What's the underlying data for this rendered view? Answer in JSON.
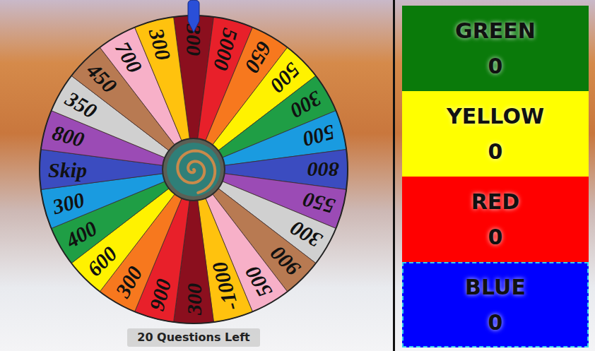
{
  "wheel": {
    "segments": [
      {
        "label": "300",
        "color": "#8b0f1e"
      },
      {
        "label": "5000",
        "color": "#e8202a"
      },
      {
        "label": "650",
        "color": "#f7781e"
      },
      {
        "label": "500",
        "color": "#fff200"
      },
      {
        "label": "300",
        "color": "#1f9e45"
      },
      {
        "label": "500",
        "color": "#1a9be0"
      },
      {
        "label": "800",
        "color": "#3b4cc0"
      },
      {
        "label": "550",
        "color": "#9b4bb5"
      },
      {
        "label": "300",
        "color": "#d0d0d0"
      },
      {
        "label": "900",
        "color": "#b87a52"
      },
      {
        "label": "500",
        "color": "#f7b0c8"
      },
      {
        "label": "-1000",
        "color": "#ffc20e"
      },
      {
        "label": "300",
        "color": "#8b0f1e"
      },
      {
        "label": "900",
        "color": "#e8202a"
      },
      {
        "label": "300",
        "color": "#f7781e"
      },
      {
        "label": "600",
        "color": "#fff200"
      },
      {
        "label": "400",
        "color": "#1f9e45"
      },
      {
        "label": "300",
        "color": "#1a9be0"
      },
      {
        "label": "Skip",
        "color": "#3b4cc0"
      },
      {
        "label": "800",
        "color": "#9b4bb5"
      },
      {
        "label": "350",
        "color": "#d0d0d0"
      },
      {
        "label": "450",
        "color": "#b87a52"
      },
      {
        "label": "700",
        "color": "#f7b0c8"
      },
      {
        "label": "300",
        "color": "#ffc20e"
      }
    ]
  },
  "status": {
    "questions_left": "20 Questions Left"
  },
  "teams": [
    {
      "name": "GREEN",
      "score": "0",
      "color": "#0a7a0a",
      "selected": false
    },
    {
      "name": "YELLOW",
      "score": "0",
      "color": "#ffff00",
      "selected": false
    },
    {
      "name": "RED",
      "score": "0",
      "color": "#ff0000",
      "selected": false
    },
    {
      "name": "BLUE",
      "score": "0",
      "color": "#0000ff",
      "selected": true
    }
  ]
}
